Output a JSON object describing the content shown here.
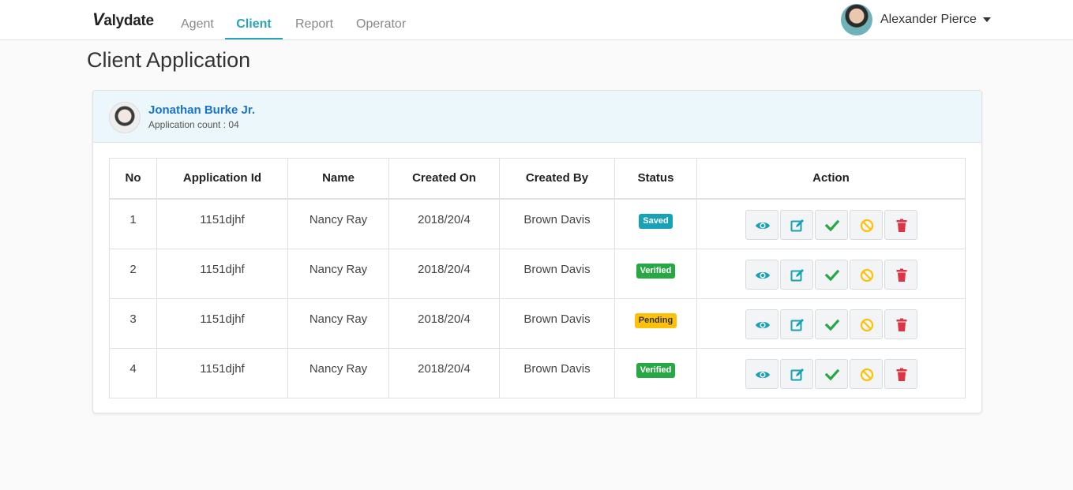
{
  "brand": {
    "logo_v": "V",
    "logo_rest": "alydate"
  },
  "nav": {
    "tabs": [
      {
        "label": "Agent"
      },
      {
        "label": "Client"
      },
      {
        "label": "Report"
      },
      {
        "label": "Operator"
      }
    ],
    "active_tab": "Client"
  },
  "user": {
    "name": "Alexander Pierce"
  },
  "page": {
    "title": "Client Application"
  },
  "client": {
    "name": "Jonathan Burke Jr.",
    "application_count": "Application count : 04"
  },
  "table": {
    "headers": [
      "No",
      "Application Id",
      "Name",
      "Created On",
      "Created By",
      "Status",
      "Action"
    ],
    "rows": [
      {
        "no": "1",
        "app_id": "1151djhf",
        "name": "Nancy Ray",
        "created_on": "2018/20/4",
        "created_by": "Brown Davis",
        "status": "Saved"
      },
      {
        "no": "2",
        "app_id": "1151djhf",
        "name": "Nancy Ray",
        "created_on": "2018/20/4",
        "created_by": "Brown Davis",
        "status": "Verified"
      },
      {
        "no": "3",
        "app_id": "1151djhf",
        "name": "Nancy Ray",
        "created_on": "2018/20/4",
        "created_by": "Brown Davis",
        "status": "Pending"
      },
      {
        "no": "4",
        "app_id": "1151djhf",
        "name": "Nancy Ray",
        "created_on": "2018/20/4",
        "created_by": "Brown Davis",
        "status": "Verified"
      }
    ]
  },
  "status_colors": {
    "Saved": "#17a2b8",
    "Verified": "#28a745",
    "Pending": "#ffc107"
  },
  "actions": [
    {
      "icon": "eye-icon",
      "color": "#17a2b8"
    },
    {
      "icon": "edit-icon",
      "color": "#17a2b8"
    },
    {
      "icon": "check-icon",
      "color": "#28a745"
    },
    {
      "icon": "ban-icon",
      "color": "#ffc107"
    },
    {
      "icon": "trash-icon",
      "color": "#dc3545"
    }
  ]
}
